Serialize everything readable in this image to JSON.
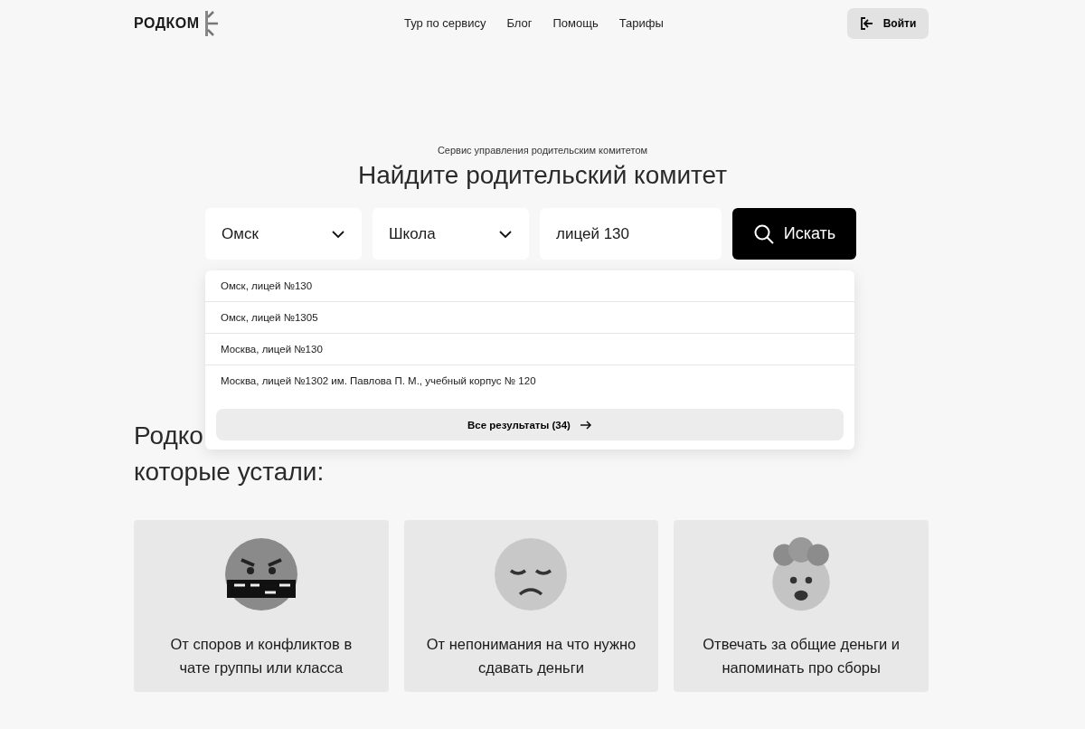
{
  "header": {
    "logo": "РОДКОМ",
    "nav": [
      "Тур по сервису",
      "Блог",
      "Помощь",
      "Тарифы"
    ],
    "login_button": "Войти"
  },
  "hero": {
    "tagline": "Сервис управления родительским комитетом",
    "title": "Найдите родительский комитет"
  },
  "search": {
    "city": "Омск",
    "institution_type": "Школа",
    "query": "лицей 130",
    "button": "Искать"
  },
  "suggestions": {
    "items": [
      "Омск, лицей №130",
      "Омск, лицей №1305",
      "Москва, лицей №130",
      "Москва, лицей №1302 им. Павлова П. М., учебный корпус № 120"
    ],
    "all_results": "Все результаты (34)"
  },
  "section": {
    "heading_lines": [
      "Родко",
      "которые устали:"
    ]
  },
  "cards": [
    {
      "kind": "angry",
      "text": "От споров и конфликтов в чате группы или класса"
    },
    {
      "kind": "sad",
      "text": "От непонимания на что нужно сдавать деньги"
    },
    {
      "kind": "exploding",
      "text": "Отвечать за общие деньги и напоминать про сборы"
    }
  ]
}
